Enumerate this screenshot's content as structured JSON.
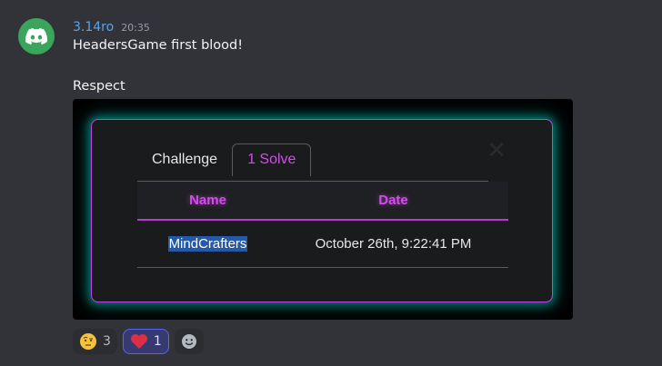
{
  "message": {
    "username": "3.14ro",
    "timestamp": "20:35",
    "line1": "HeadersGame first blood!",
    "line2": "Respect"
  },
  "modal": {
    "tabs": [
      {
        "label": "Challenge",
        "active": false
      },
      {
        "label": "1 Solve",
        "active": true
      }
    ],
    "table": {
      "headers": [
        "Name",
        "Date"
      ],
      "rows": [
        {
          "name": "MindCrafters",
          "date": "October 26th, 9:22:41 PM"
        }
      ]
    }
  },
  "reactions": [
    {
      "emoji": "face-with-raised-eyebrow",
      "count": "3",
      "me": false
    },
    {
      "emoji": "red-heart",
      "count": "1",
      "me": true
    }
  ],
  "colors": {
    "username": "#5ba3e6",
    "accent_magenta": "#d54bf0",
    "glow_teal": "#00c8be",
    "avatar_green": "#3ba55c"
  }
}
